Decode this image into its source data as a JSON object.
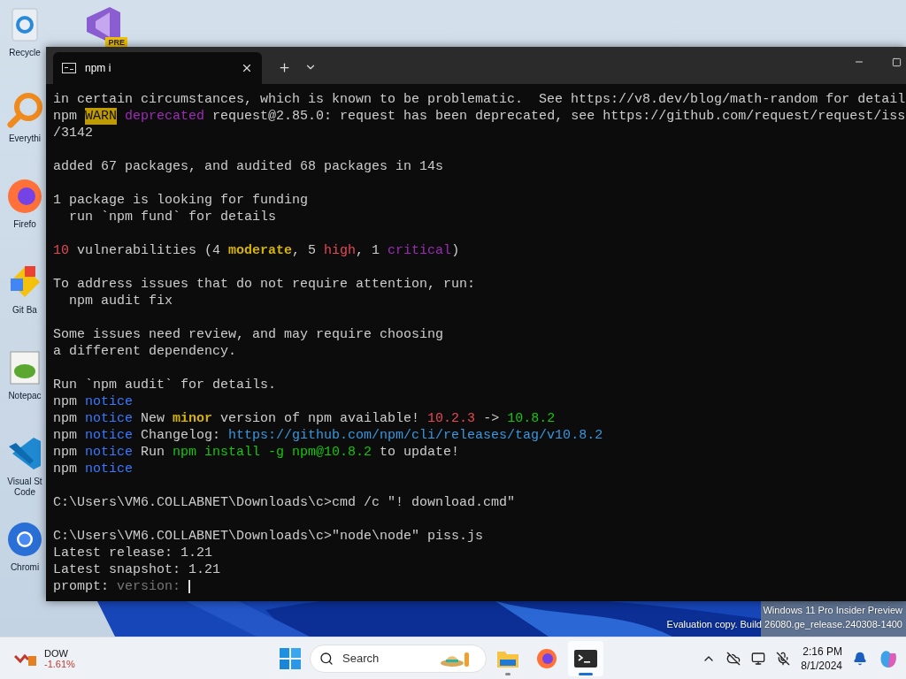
{
  "desktop_icons": [
    {
      "kind": "recycle",
      "label": "Recycle"
    },
    {
      "kind": "vs",
      "badge": "PRE"
    },
    {
      "kind": "everything",
      "label": "Everythi"
    },
    {
      "kind": "firefox",
      "label": "Firefo"
    },
    {
      "kind": "git",
      "label": "Git Ba"
    },
    {
      "kind": "notepad",
      "label": "Notepac"
    },
    {
      "kind": "vscode",
      "label": "Visual St",
      "label_2": "Code"
    },
    {
      "kind": "chromium",
      "label": "Chromi"
    }
  ],
  "terminal": {
    "tab": {
      "title": "npm i",
      "selected": true
    },
    "blocks": [
      [
        [
          {
            "text": "in certain circumstances, which is known to be problematic.  See https://v8.dev/blog/math-random for detail",
            "kind": "plain"
          }
        ],
        [
          {
            "text": "npm ",
            "kind": "plain"
          },
          {
            "text": "WARN",
            "kind": "warn"
          },
          {
            "text": " deprecated",
            "kind": "magenta"
          },
          {
            "text": " request@2.85.0: request has been deprecated, see https://github.com/request/request/iss",
            "kind": "plain"
          }
        ],
        [
          {
            "text": "/3142",
            "kind": "plain"
          }
        ]
      ],
      [
        [
          {
            "text": "added 67 packages, and audited 68 packages in 14s",
            "kind": "plain"
          }
        ]
      ],
      [
        [
          {
            "text": "1 package is looking for funding",
            "kind": "plain"
          }
        ],
        [
          {
            "text": "  run `npm fund` for details",
            "kind": "plain"
          }
        ]
      ],
      [
        [
          {
            "text": "10",
            "kind": "red"
          },
          {
            "text": " vulnerabilities (4 ",
            "kind": "plain"
          },
          {
            "text": "moderate",
            "kind": "yellow"
          },
          {
            "text": ", 5 ",
            "kind": "plain"
          },
          {
            "text": "high",
            "kind": "red"
          },
          {
            "text": ", 1 ",
            "kind": "plain"
          },
          {
            "text": "critical",
            "kind": "magenta"
          },
          {
            "text": ")",
            "kind": "plain"
          }
        ]
      ],
      [
        [
          {
            "text": "To address issues that do not require attention, run:",
            "kind": "plain"
          }
        ],
        [
          {
            "text": "  npm audit fix",
            "kind": "plain"
          }
        ]
      ],
      [
        [
          {
            "text": "Some issues need review, and may require choosing",
            "kind": "plain"
          }
        ],
        [
          {
            "text": "a different dependency.",
            "kind": "plain"
          }
        ]
      ],
      [
        [
          {
            "text": "Run `npm audit` for details.",
            "kind": "plain"
          }
        ],
        [
          {
            "text": "npm ",
            "kind": "plain"
          },
          {
            "text": "notice",
            "kind": "blue"
          }
        ],
        [
          {
            "text": "npm ",
            "kind": "plain"
          },
          {
            "text": "notice",
            "kind": "blue"
          },
          {
            "text": " New ",
            "kind": "plain"
          },
          {
            "text": "minor",
            "kind": "yellow"
          },
          {
            "text": " version of npm available! ",
            "kind": "plain"
          },
          {
            "text": "10.2.3",
            "kind": "red"
          },
          {
            "text": " -> ",
            "kind": "plain"
          },
          {
            "text": "10.8.2",
            "kind": "green"
          }
        ],
        [
          {
            "text": "npm ",
            "kind": "plain"
          },
          {
            "text": "notice",
            "kind": "blue"
          },
          {
            "text": " Changelog: ",
            "kind": "plain"
          },
          {
            "text": "https://github.com/npm/cli/releases/tag/v10.8.2",
            "kind": "link"
          }
        ],
        [
          {
            "text": "npm ",
            "kind": "plain"
          },
          {
            "text": "notice",
            "kind": "blue"
          },
          {
            "text": " Run ",
            "kind": "plain"
          },
          {
            "text": "npm install -g npm@10.8.2",
            "kind": "green"
          },
          {
            "text": " to update!",
            "kind": "plain"
          }
        ],
        [
          {
            "text": "npm ",
            "kind": "plain"
          },
          {
            "text": "notice",
            "kind": "blue"
          }
        ]
      ],
      [
        [
          {
            "text": "C:\\Users\\VM6.COLLABNET\\Downloads\\c>cmd /c \"! download.cmd\"",
            "kind": "plain"
          }
        ]
      ],
      [
        [
          {
            "text": "C:\\Users\\VM6.COLLABNET\\Downloads\\c>\"node\\node\" piss.js",
            "kind": "plain"
          }
        ],
        [
          {
            "text": "Latest release: 1.21",
            "kind": "plain"
          }
        ],
        [
          {
            "text": "Latest snapshot: 1.21",
            "kind": "plain"
          }
        ],
        [
          {
            "text": "prompt: ",
            "kind": "plain"
          },
          {
            "text": "version:",
            "kind": "gray"
          }
        ]
      ]
    ]
  },
  "watermark": {
    "line_1": "Windows 11 Pro Insider Preview",
    "line_2": "Evaluation copy. Build 26080.ge_release.240308-1400"
  },
  "taskbar": {
    "widget": {
      "title": "DOW",
      "value": "-1.61%"
    },
    "search": {
      "placeholder": "Search"
    },
    "apps": [
      {
        "kind": "files",
        "running": true,
        "selected": false
      },
      {
        "kind": "firefox",
        "running": false,
        "selected": false
      },
      {
        "kind": "terminal",
        "running": true,
        "selected": true
      }
    ],
    "time": "2:16 PM",
    "date": "8/1/2024"
  }
}
